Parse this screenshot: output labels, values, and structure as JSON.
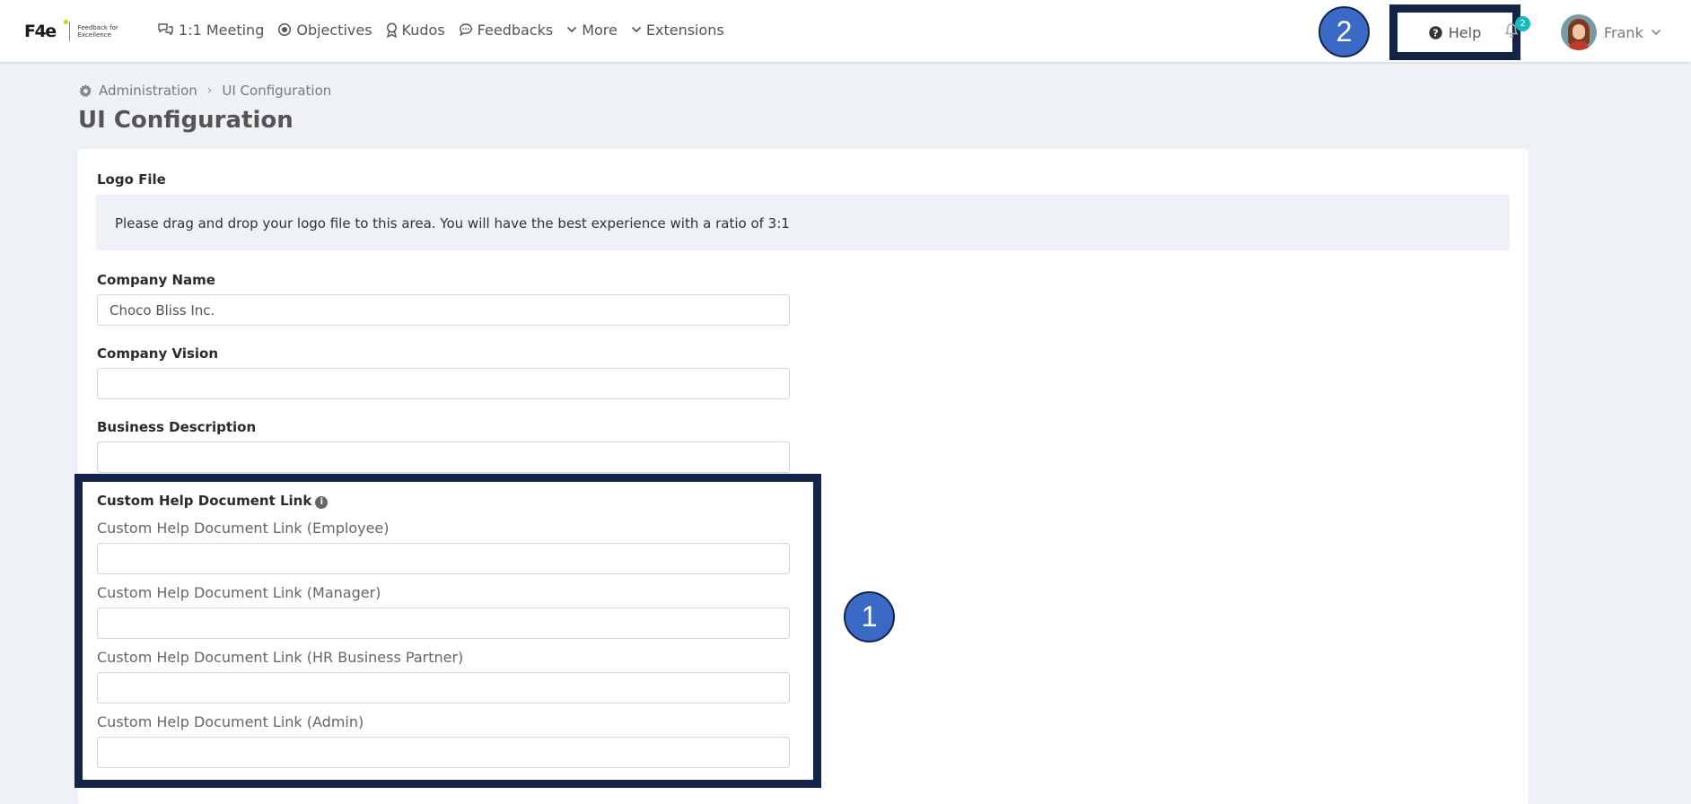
{
  "logo": {
    "mark": "F4e",
    "tagline": "Feedback for Excellence"
  },
  "nav": {
    "items": [
      {
        "label": "1:1 Meeting",
        "icon": "chat-bubbles-icon"
      },
      {
        "label": "Objectives",
        "icon": "target-icon"
      },
      {
        "label": "Kudos",
        "icon": "award-icon"
      },
      {
        "label": "Feedbacks",
        "icon": "comment-icon"
      },
      {
        "label": "More",
        "icon": "chevron-down-icon"
      },
      {
        "label": "Extensions",
        "icon": "chevron-down-icon"
      }
    ],
    "help_label": "Help",
    "notification_count": "2",
    "user_name": "Frank"
  },
  "markers": {
    "one": "1",
    "two": "2"
  },
  "breadcrumb": {
    "root": "Administration",
    "current": "UI Configuration"
  },
  "page_title": "UI Configuration",
  "form": {
    "logo_file_label": "Logo File",
    "logo_dropzone_text": "Please drag and drop your logo file to this area. You will have the best experience with a ratio of 3:1",
    "company_name_label": "Company Name",
    "company_name_value": "Choco Bliss Inc.",
    "company_vision_label": "Company Vision",
    "company_vision_value": "",
    "business_description_label": "Business Description",
    "business_description_value": "",
    "custom_help_label": "Custom Help Document Link",
    "custom_help_fields": [
      {
        "label": "Custom Help Document Link (Employee)",
        "value": ""
      },
      {
        "label": "Custom Help Document Link (Manager)",
        "value": ""
      },
      {
        "label": "Custom Help Document Link (HR Business Partner)",
        "value": ""
      },
      {
        "label": "Custom Help Document Link (Admin)",
        "value": ""
      }
    ]
  },
  "colors": {
    "highlight_border": "#142449",
    "marker_fill": "#3a6ac6",
    "badge": "#16b9bd",
    "page_background": "#eef1f5"
  }
}
